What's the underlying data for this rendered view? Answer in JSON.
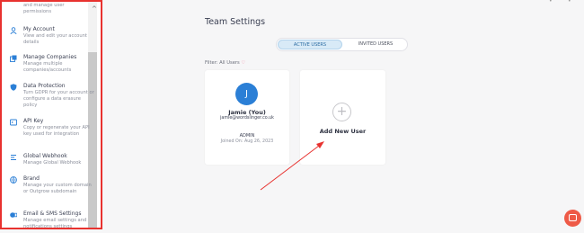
{
  "sidebar": {
    "partial_top_text": "and manage user\npermissions",
    "items": [
      {
        "icon": "user-icon",
        "title": "My Account",
        "desc": "View and edit your account details"
      },
      {
        "icon": "companies-icon",
        "title": "Manage Companies",
        "desc": "Manage multiple companies/accounts"
      },
      {
        "icon": "shield-icon",
        "title": "Data Protection",
        "desc": "Turn GDPR for your account or configure a data erasure policy"
      },
      {
        "icon": "api-icon",
        "title": "API Key",
        "desc": "Copy or regenerate your API key used for integration"
      },
      {
        "icon": "webhook-icon",
        "title": "Global Webhook",
        "desc": "Manage Global Webhook"
      },
      {
        "icon": "globe-icon",
        "title": "Brand",
        "desc": "Manage your custom domain or Outgrow subdomain"
      },
      {
        "icon": "mail-icon",
        "title": "Email & SMS Settings",
        "desc": "Manage email settings and notifications settings"
      }
    ]
  },
  "main": {
    "title": "Team Settings",
    "tabs": [
      {
        "label": "ACTIVE USERS",
        "active": true
      },
      {
        "label": "INVITED USERS",
        "active": false
      }
    ],
    "filter_label": "Filter: All Users"
  },
  "user_card": {
    "initial": "J",
    "name": "Jamie (You)",
    "email": "jamie@wordslinger.co.uk",
    "role": "ADMIN",
    "joined": "Joined On: Aug 26, 2023"
  },
  "add_card": {
    "label": "Add New User"
  },
  "colors": {
    "highlight_border": "#e8322f",
    "avatar": "#2b7fd6",
    "chat": "#ee5a47",
    "tab_active_bg": "#d8eaf7"
  }
}
